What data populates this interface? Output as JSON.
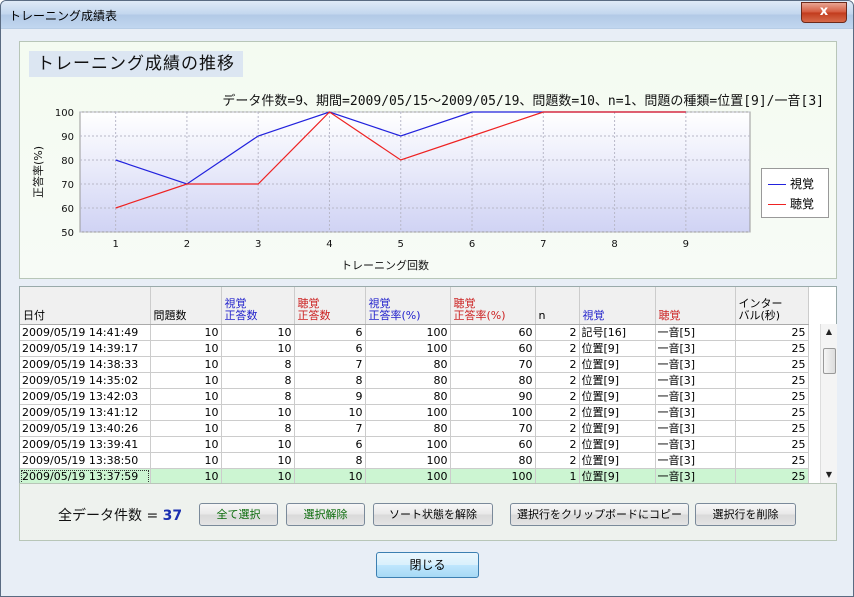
{
  "window": {
    "title": "トレーニング成績表",
    "close_glyph": "x"
  },
  "chart": {
    "title": "トレーニング成績の推移",
    "subtitle": "データ件数=9、期間=2009/05/15～2009/05/19、問題数=10、n=1、問題の種類=位置[9]/一音[3]"
  },
  "chart_data": {
    "type": "line",
    "x": [
      1,
      2,
      3,
      4,
      5,
      6,
      7,
      8,
      9
    ],
    "series": [
      {
        "name": "視覚",
        "color": "#2222dd",
        "values": [
          80,
          70,
          90,
          100,
          90,
          100,
          100,
          100,
          100
        ]
      },
      {
        "name": "聴覚",
        "color": "#ee2222",
        "values": [
          60,
          70,
          70,
          100,
          80,
          90,
          100,
          100,
          100
        ]
      }
    ],
    "xlabel": "トレーニング回数",
    "ylabel": "正答率(%)",
    "xlim": [
      0.5,
      9.9
    ],
    "ylim": [
      50,
      100
    ],
    "yticks": [
      50,
      60,
      70,
      80,
      90,
      100
    ],
    "grid": true,
    "legend": "right"
  },
  "table": {
    "headers": [
      {
        "l1": "",
        "l2": "日付",
        "color": "#000000"
      },
      {
        "l1": "",
        "l2": "問題数",
        "color": "#000000"
      },
      {
        "l1": "視覚",
        "l2": "正答数",
        "color": "#2222cc"
      },
      {
        "l1": "聴覚",
        "l2": "正答数",
        "color": "#cc2222"
      },
      {
        "l1": "視覚",
        "l2": "正答率(%)",
        "color": "#2222cc"
      },
      {
        "l1": "聴覚",
        "l2": "正答率(%)",
        "color": "#cc2222"
      },
      {
        "l1": "",
        "l2": "n",
        "color": "#000000"
      },
      {
        "l1": "",
        "l2": "視覚",
        "color": "#2222cc"
      },
      {
        "l1": "",
        "l2": "聴覚",
        "color": "#cc2222"
      },
      {
        "l1": "インター",
        "l2": "バル(秒)",
        "color": "#000000"
      }
    ],
    "rows": [
      [
        "2009/05/19 14:41:49",
        "10",
        "10",
        "6",
        "100",
        "60",
        "2",
        "記号[16]",
        "一音[5]",
        "25"
      ],
      [
        "2009/05/19 14:39:17",
        "10",
        "10",
        "6",
        "100",
        "60",
        "2",
        "位置[9]",
        "一音[3]",
        "25"
      ],
      [
        "2009/05/19 14:38:33",
        "10",
        "8",
        "7",
        "80",
        "70",
        "2",
        "位置[9]",
        "一音[3]",
        "25"
      ],
      [
        "2009/05/19 14:35:02",
        "10",
        "8",
        "8",
        "80",
        "80",
        "2",
        "位置[9]",
        "一音[3]",
        "25"
      ],
      [
        "2009/05/19 13:42:03",
        "10",
        "8",
        "9",
        "80",
        "90",
        "2",
        "位置[9]",
        "一音[3]",
        "25"
      ],
      [
        "2009/05/19 13:41:12",
        "10",
        "10",
        "10",
        "100",
        "100",
        "2",
        "位置[9]",
        "一音[3]",
        "25"
      ],
      [
        "2009/05/19 13:40:26",
        "10",
        "8",
        "7",
        "80",
        "70",
        "2",
        "位置[9]",
        "一音[3]",
        "25"
      ],
      [
        "2009/05/19 13:39:41",
        "10",
        "10",
        "6",
        "100",
        "60",
        "2",
        "位置[9]",
        "一音[3]",
        "25"
      ],
      [
        "2009/05/19 13:38:50",
        "10",
        "10",
        "8",
        "100",
        "80",
        "2",
        "位置[9]",
        "一音[3]",
        "25"
      ],
      [
        "2009/05/19 13:37:59",
        "10",
        "10",
        "10",
        "100",
        "100",
        "1",
        "位置[9]",
        "一音[3]",
        "25"
      ]
    ],
    "selected_row": 9,
    "scroll_up": "▲",
    "scroll_down": "▼"
  },
  "footer": {
    "count_label": "全データ件数 = ",
    "count_value": "37",
    "buttons": {
      "select_all": "全て選択",
      "deselect": "選択解除",
      "clear_sort": "ソート状態を解除",
      "copy_clipboard": "選択行をクリップボードにコピー",
      "delete_rows": "選択行を削除"
    },
    "close": "閉じる"
  }
}
